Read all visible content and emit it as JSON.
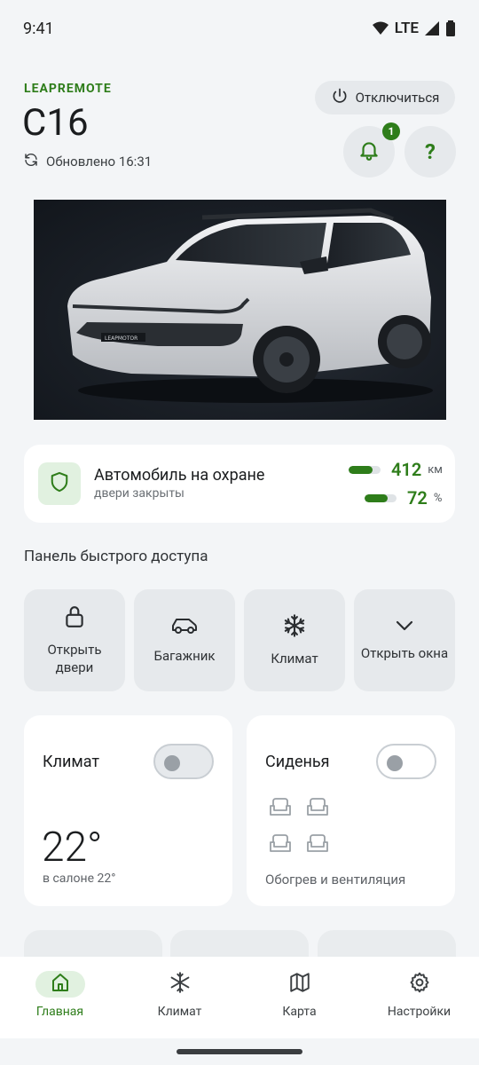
{
  "status_bar": {
    "time": "9:41",
    "network": "LTE",
    "icons": [
      "wifi-icon",
      "signal-icon",
      "battery-icon"
    ]
  },
  "header": {
    "brand": "LEAPREMOTE",
    "car_name": "C16",
    "updated_label": "Обновлено 16:31",
    "disconnect_label": "Отключиться",
    "notification_count": "1",
    "help_label": "?"
  },
  "car_image": {
    "plate_text": "LEAPMOTOR"
  },
  "status_card": {
    "title": "Автомобиль на охране",
    "subtitle": "двери закрыты",
    "range": {
      "value": "412",
      "unit": "км",
      "level": 0.75
    },
    "battery": {
      "value": "72",
      "unit": "%",
      "level": 0.72
    }
  },
  "quick_panel": {
    "title": "Панель быстрого доступа",
    "buttons": [
      {
        "label": "Открыть двери",
        "icon": "lock-icon"
      },
      {
        "label": "Багажник",
        "icon": "car-icon"
      },
      {
        "label": "Климат",
        "icon": "snowflake-icon"
      },
      {
        "label": "Открыть окна",
        "icon": "chevron-down-icon"
      }
    ]
  },
  "climate_tile": {
    "title": "Климат",
    "temperature": "22°",
    "subtitle": "в салоне 22°",
    "enabled": false
  },
  "seats_tile": {
    "title": "Сиденья",
    "subtitle": "Обогрев и вентиляция",
    "enabled": false
  },
  "bottom_nav": {
    "items": [
      {
        "label": "Главная",
        "icon": "home-icon",
        "active": true
      },
      {
        "label": "Климат",
        "icon": "snowflake-icon",
        "active": false
      },
      {
        "label": "Карта",
        "icon": "map-icon",
        "active": false
      },
      {
        "label": "Настройки",
        "icon": "gear-icon",
        "active": false
      }
    ]
  },
  "colors": {
    "accent": "#2e7d1a",
    "background": "#f3f5f7",
    "card": "#ffffff",
    "button": "#e6e9ec"
  }
}
